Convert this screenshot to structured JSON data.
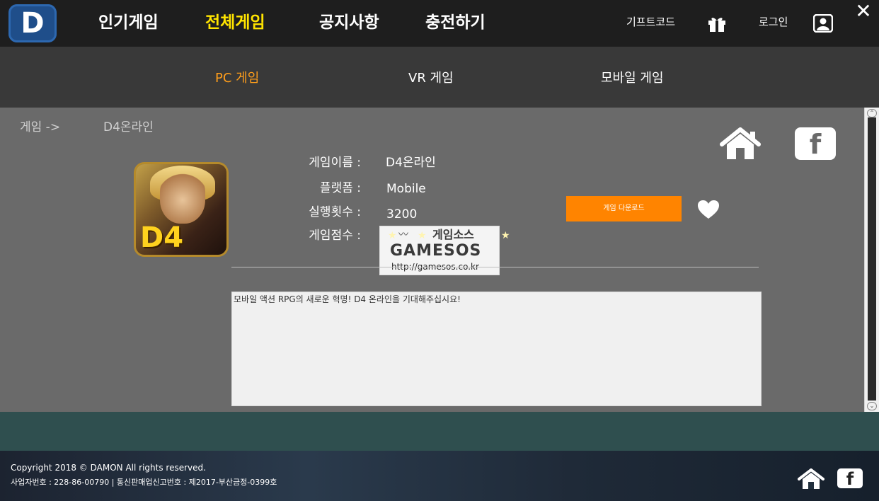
{
  "logo": {
    "letter": "D"
  },
  "nav": {
    "items": [
      "인기게임",
      "전체게임",
      "공지사항",
      "충전하기"
    ],
    "active": "전체게임"
  },
  "top_right": {
    "gift_code": "기프트코드",
    "login": "로그인"
  },
  "close_icon": "close-icon",
  "subnav": {
    "tabs": [
      "PC 게임",
      "VR 게임",
      "모바일 게임"
    ],
    "active": "PC 게임"
  },
  "breadcrumb": {
    "root": "게임 ->",
    "current": "D4온라인"
  },
  "game": {
    "image_text": "D4",
    "labels": {
      "name": "게임이름 :",
      "platform": "플랫폼 :",
      "runs": "실행횟수 :",
      "score": "게임점수 :"
    },
    "name": "D4온라인",
    "platform": "Mobile",
    "runs": "3200",
    "download_label": "게임 다운로드",
    "description": "모바일 액션 RPG의 새로운 혁명! D4 온라인을 기대해주십시요!"
  },
  "watermark": {
    "title": "게임소스",
    "brand": "GAMESOS",
    "url": "http://gamesos.co.kr"
  },
  "footer": {
    "copyright": "Copyright 2018 © DAMON All rights reserved.",
    "business": "사업자번호 : 228-86-00790 | 통신판매업신고번호 : 제2017-부산금정-0399호"
  },
  "colors": {
    "active_nav": "#ffe400",
    "active_subtab": "#ff9e1b",
    "download_button": "#ff8400",
    "band": "#2f4f4f"
  }
}
